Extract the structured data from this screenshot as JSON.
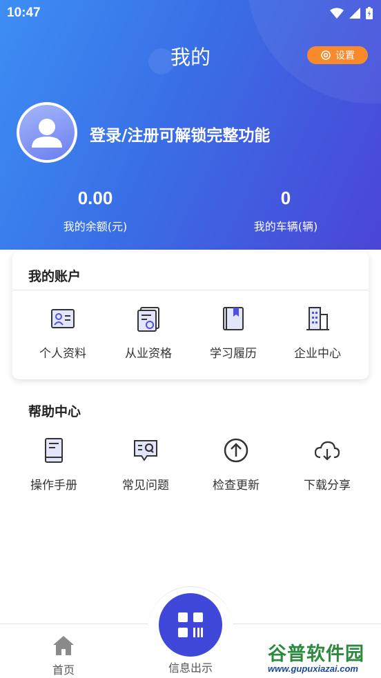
{
  "status_bar": {
    "time": "10:47"
  },
  "header": {
    "title": "我的",
    "settings_label": "设置",
    "login_prompt": "登录/注册可解锁完整功能",
    "stats": [
      {
        "value": "0.00",
        "label": "我的余额(元)"
      },
      {
        "value": "0",
        "label": "我的车辆(辆)"
      }
    ]
  },
  "account": {
    "title": "我的账户",
    "items": [
      {
        "label": "个人资料",
        "icon": "id-card-icon"
      },
      {
        "label": "从业资格",
        "icon": "certificate-icon"
      },
      {
        "label": "学习履历",
        "icon": "book-icon"
      },
      {
        "label": "企业中心",
        "icon": "building-icon"
      }
    ]
  },
  "help": {
    "title": "帮助中心",
    "items": [
      {
        "label": "操作手册",
        "icon": "manual-icon"
      },
      {
        "label": "常见问题",
        "icon": "faq-icon"
      },
      {
        "label": "检查更新",
        "icon": "update-icon"
      },
      {
        "label": "下载分享",
        "icon": "cloud-download-icon"
      }
    ]
  },
  "bottom_nav": {
    "items": [
      {
        "label": "首页",
        "icon": "home-icon"
      },
      {
        "label": "信息出示",
        "icon": "qr-code-icon"
      }
    ]
  },
  "watermark": {
    "title": "谷普软件园",
    "url": "www.gupuxiazai.com"
  },
  "colors": {
    "header_start": "#3d8ef5",
    "header_end": "#4b45d6",
    "accent": "#3f48d8",
    "settings_button": "#f88a2c"
  }
}
